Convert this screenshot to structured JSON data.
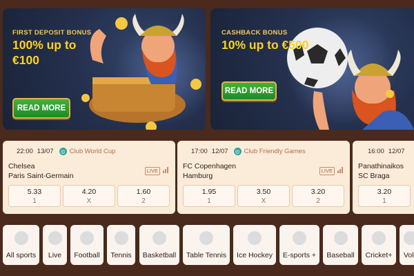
{
  "banners": [
    {
      "tag": "FIRST DEPOSIT BONUS",
      "line1": "100% up to",
      "line2": "€100",
      "cta": "READ MORE"
    },
    {
      "tag": "CASHBACK BONUS",
      "line1": "10% up to €500",
      "cta": "READ MORE"
    }
  ],
  "matches": [
    {
      "time": "22:00",
      "date": "13/07",
      "competition": "Club World Cup",
      "home": "Chelsea",
      "away": "Paris Saint-Germain",
      "live": "LIVE",
      "odds": [
        {
          "value": "5.33",
          "label": "1"
        },
        {
          "value": "4.20",
          "label": "X"
        },
        {
          "value": "1.60",
          "label": "2"
        }
      ]
    },
    {
      "time": "17:00",
      "date": "12/07",
      "competition": "Club Friendly Games",
      "home": "FC Copenhagen",
      "away": "Hamburg",
      "live": "LIVE",
      "odds": [
        {
          "value": "1.95",
          "label": "1"
        },
        {
          "value": "3.50",
          "label": "X"
        },
        {
          "value": "3.20",
          "label": "2"
        }
      ]
    },
    {
      "time": "16:00",
      "date": "12/07",
      "home": "Panathinaikos",
      "away": "SC Braga",
      "odds": [
        {
          "value": "3.20",
          "label": "1"
        }
      ]
    }
  ],
  "sports": [
    "All sports",
    "Live",
    "Football",
    "Tennis",
    "Basketball",
    "Table Tennis",
    "Ice Hockey",
    "E-sports +",
    "Baseball",
    "Cricket+",
    "Vol"
  ],
  "colors": {
    "background": "#4a2a1c",
    "card": "#fbecd9",
    "accent_yellow": "#ffd21f",
    "cta_green": "#2e9e2f"
  }
}
